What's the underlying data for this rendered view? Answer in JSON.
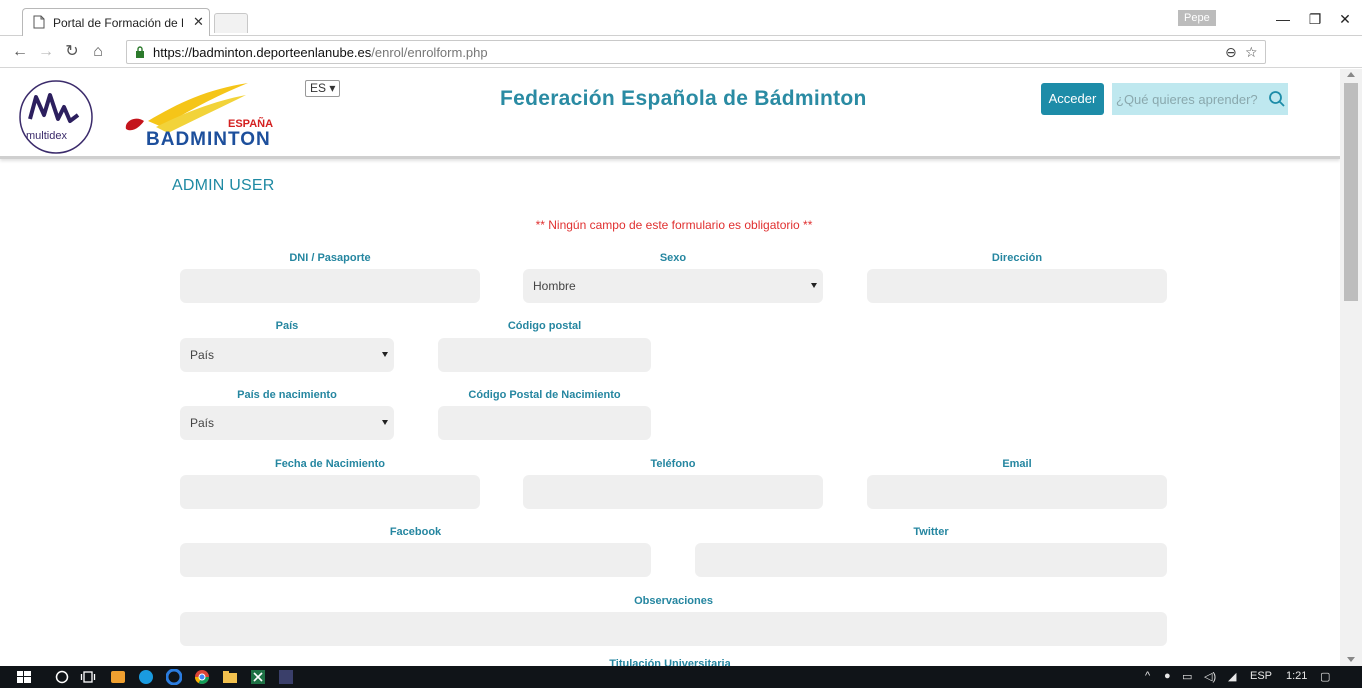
{
  "browser": {
    "tab_title": "Portal de Formación de l",
    "profile_name": "Pepe",
    "url_scheme_host": "https://badminton.deporteenlanube.es",
    "url_path": "/enrol/enrolform.php"
  },
  "header": {
    "logo_left_text": "multidex",
    "logo_right_top": "ESPAÑA",
    "logo_right_bottom": "BADMINTON",
    "language": "ES ▾",
    "site_title": "Federación Española de Bádminton",
    "login_label": "Acceder",
    "search_placeholder": "¿Qué quieres aprender?"
  },
  "form": {
    "title": "ADMIN USER",
    "notice": "** Ningún campo de este formulario es obligatorio **",
    "labels": {
      "dni": "DNI / Pasaporte",
      "sexo": "Sexo",
      "direccion": "Dirección",
      "pais": "País",
      "codigo_postal": "Código postal",
      "pais_nacimiento": "País de nacimiento",
      "cp_nacimiento": "Código Postal de Nacimiento",
      "fecha_nacimiento": "Fecha de Nacimiento",
      "telefono": "Teléfono",
      "email": "Email",
      "facebook": "Facebook",
      "twitter": "Twitter",
      "observaciones": "Observaciones",
      "titulacion": "Titulación Universitaria"
    },
    "values": {
      "sexo": "Hombre",
      "pais": "País",
      "pais_nacimiento": "País"
    }
  },
  "taskbar": {
    "language": "ESP",
    "time": "1:21"
  },
  "colors": {
    "accent": "#1d8ca8",
    "title": "#2a8ba3",
    "notice": "#e03030",
    "field_bg": "#efefef"
  }
}
